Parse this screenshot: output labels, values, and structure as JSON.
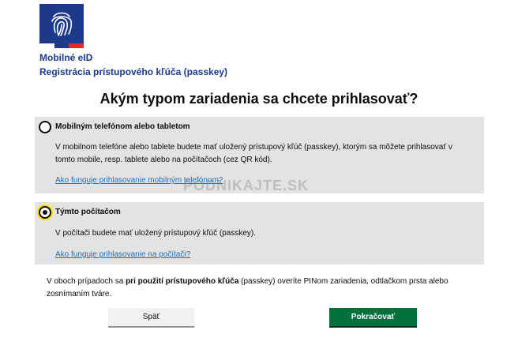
{
  "header": {
    "app_title": "Mobilné eID",
    "app_subtitle": "Registrácia prístupového kľúča (passkey)"
  },
  "logo": {
    "icon": "fingerprint-icon",
    "colors": {
      "background": "#1d3a8a",
      "flag": [
        "#ffffff",
        "#1d3a8a",
        "#e3292f"
      ]
    }
  },
  "page_title": "Akým typom zariadenia sa chcete prihlasovať?",
  "options": [
    {
      "label": "Mobilným telefónom alebo tabletom",
      "selected": false,
      "description": "V mobilnom telefóne alebo tablete budete mať uložený prístupový kľúč (passkey), ktorým sa môžete prihlasovať v tomto mobile, resp. tablete alebo na počítačoch (cez QR kód).",
      "link": "Ako funguje prihlasovanie mobilným telefónom?"
    },
    {
      "label": "Týmto počítačom",
      "selected": true,
      "description": "V počítači budete mať uložený prístupový kľúč (passkey).",
      "link": "Ako funguje prihlasovanie na počítači?"
    }
  ],
  "note": {
    "before": "V oboch prípadoch sa ",
    "bold": "pri použití prístupového kľúča",
    "after": " (passkey) overíte PINom zariadenia, odtlačkom prsta alebo zosnímaním tváre."
  },
  "buttons": {
    "back": "Späť",
    "continue": "Pokračovať"
  },
  "watermark": "PODNIKAJTE.SK",
  "colors": {
    "brand": "#1d3a8a",
    "option_background": "#e3e3e3",
    "link": "#1d70b8",
    "primary_button": "#00703c",
    "focus": "#ffdd00"
  }
}
